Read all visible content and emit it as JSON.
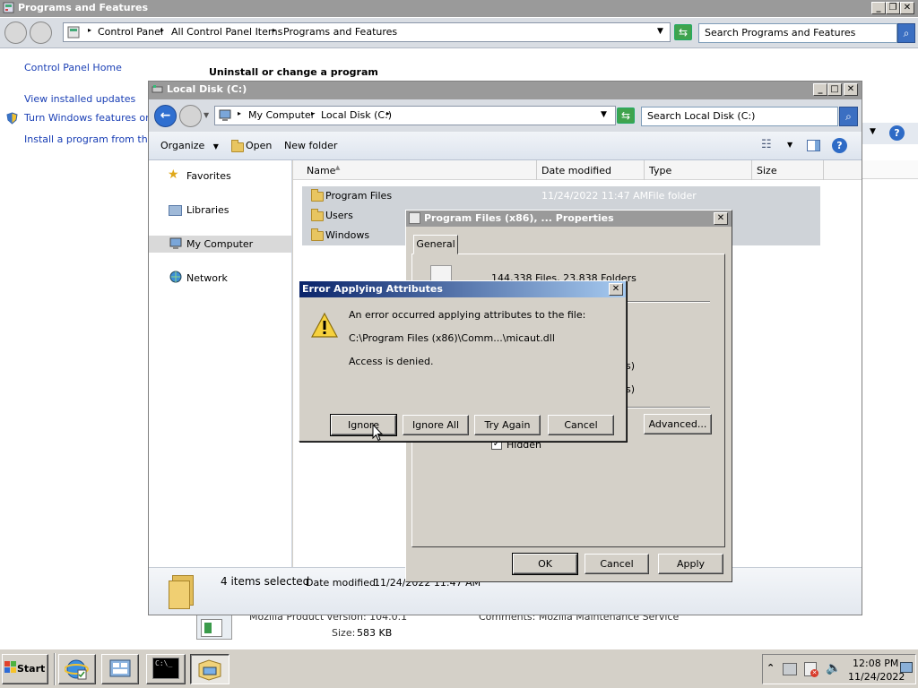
{
  "desktop_window": {
    "title": "Programs and Features",
    "breadcrumb": [
      "Control Panel",
      "All Control Panel Items",
      "Programs and Features"
    ],
    "search_placeholder": "Search Programs and Features",
    "sidebar_links": [
      "Control Panel Home",
      "View installed updates",
      "Turn Windows features on o",
      "Install a program from the ne"
    ],
    "heading": "Uninstall or change a program",
    "details": {
      "product_version_label": "Mozilla Product version: 104.0.1",
      "comments_label": "Comments: Mozilla Maintenance Service",
      "size_label": "Size:",
      "size_value": "583 KB"
    }
  },
  "explorer": {
    "title": "Local Disk (C:)",
    "breadcrumb": [
      "My Computer",
      "Local Disk (C:)"
    ],
    "search_placeholder": "Search Local Disk (C:)",
    "toolbar": {
      "organize": "Organize",
      "open": "Open",
      "new_folder": "New folder"
    },
    "nav": [
      "Favorites",
      "Libraries",
      "My Computer",
      "Network"
    ],
    "columns": [
      "Name",
      "Date modified",
      "Type",
      "Size"
    ],
    "rows": [
      {
        "name": "Program Files",
        "date": "11/24/2022 11:47 AM",
        "type": "File folder"
      },
      {
        "name": "Users",
        "date": "",
        "type": ""
      },
      {
        "name": "Windows",
        "date": "",
        "type": ""
      }
    ],
    "status": {
      "count": "4 items selected",
      "date_label": "Date modified:",
      "date_value": "11/24/2022 11:47 AM"
    }
  },
  "properties": {
    "title": "Program Files (x86), ... Properties",
    "tab": "General",
    "contains": "144,338 Files, 23,838 Folders",
    "fragment_1": "s)",
    "fragment_2": "s)",
    "advanced": "Advanced...",
    "hidden": "Hidden",
    "ok": "OK",
    "cancel": "Cancel",
    "apply": "Apply"
  },
  "error_dialog": {
    "title": "Error Applying Attributes",
    "line1": "An error occurred applying attributes to the file:",
    "path": "C:\\Program Files (x86)\\Comm...\\micaut.dll",
    "line3": "Access is denied.",
    "buttons": {
      "ignore": "Ignore",
      "ignore_all": "Ignore All",
      "try_again": "Try Again",
      "cancel": "Cancel"
    }
  },
  "taskbar": {
    "start": "Start",
    "time": "12:08 PM",
    "date": "11/24/2022"
  },
  "colors": {
    "accent": "#0a246a",
    "link": "#1a3fb5",
    "face": "#d4d0c8"
  }
}
